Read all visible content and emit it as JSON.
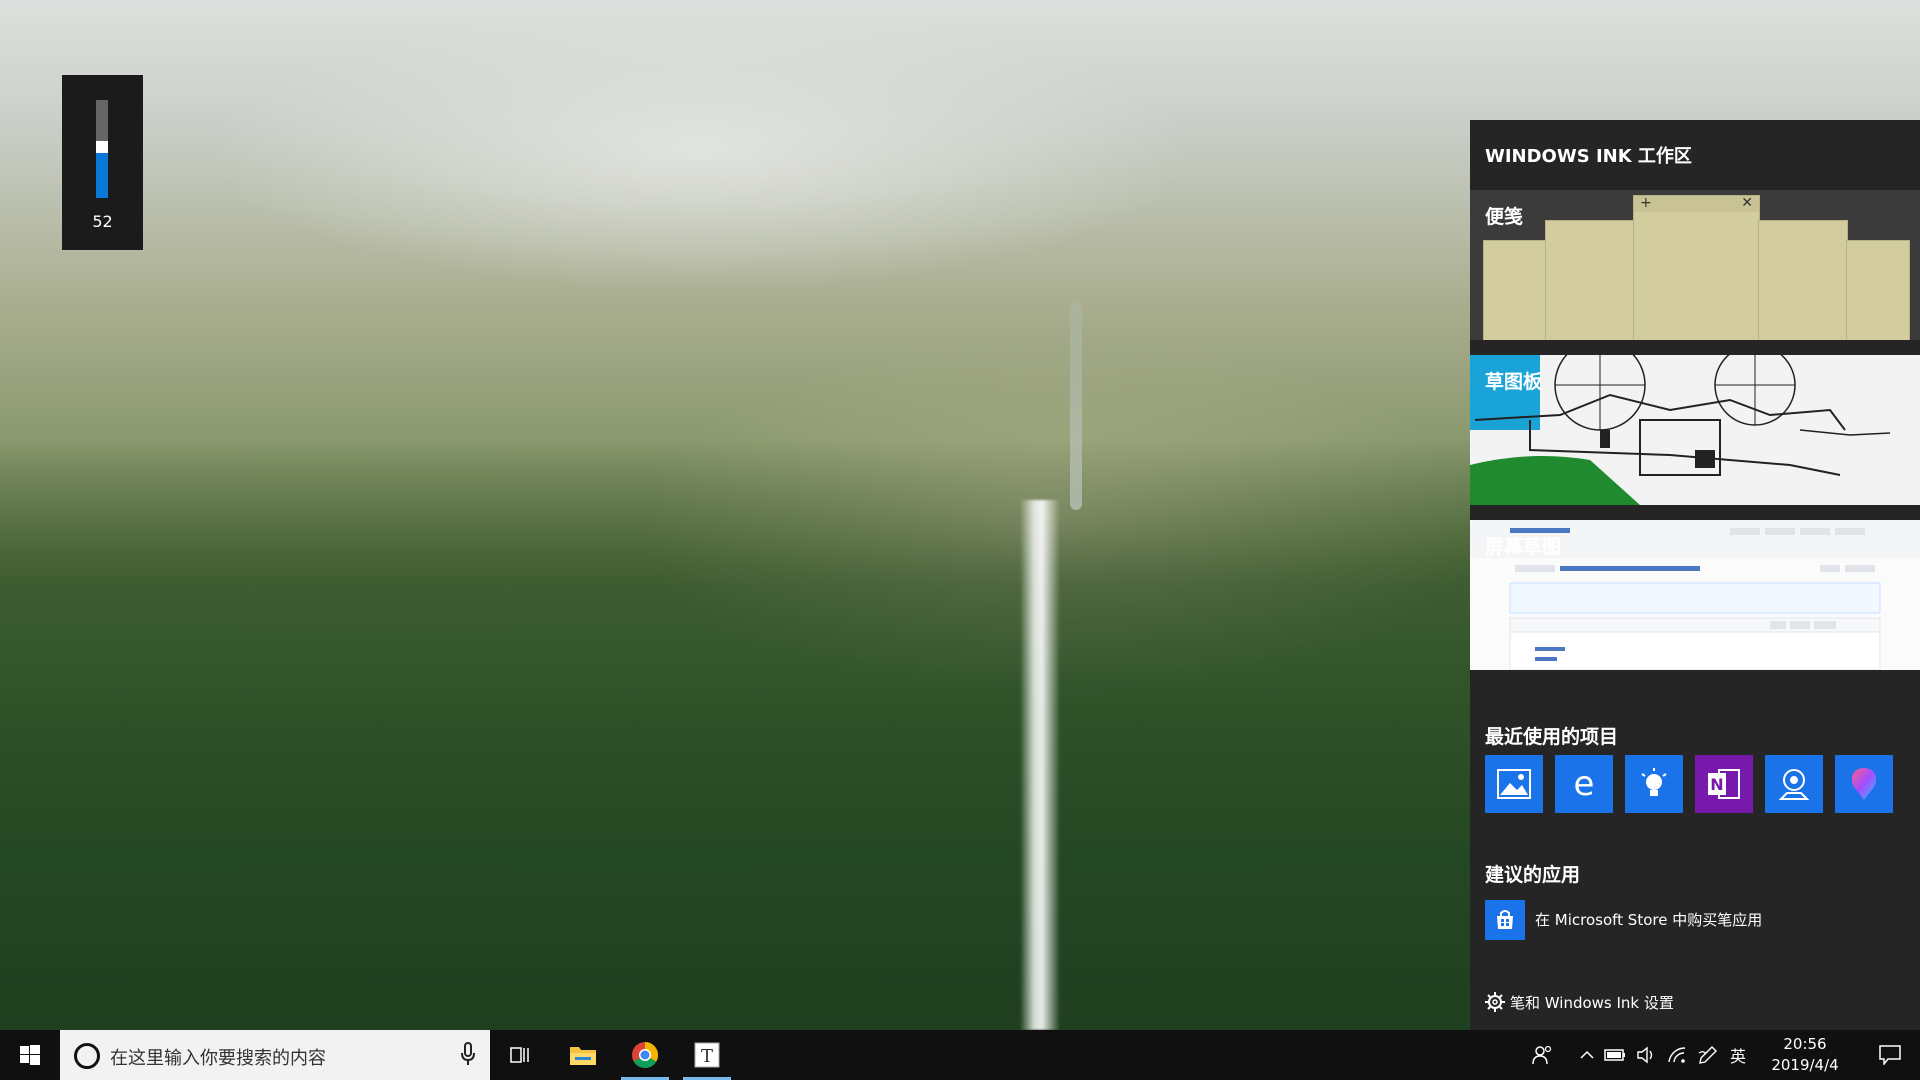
{
  "volume": {
    "level": 52,
    "label": "52"
  },
  "ink_workspace": {
    "title": "WINDOWS INK 工作区",
    "cards": {
      "sticky_notes": "便笺",
      "sketchpad": "草图板",
      "screen_sketch": "屏幕草图"
    },
    "recent_title": "最近使用的项目",
    "recent_apps": [
      {
        "name": "photos-icon",
        "color": "#1a73e8"
      },
      {
        "name": "edge-icon",
        "color": "#1a73e8"
      },
      {
        "name": "tips-icon",
        "color": "#1a73e8"
      },
      {
        "name": "onenote-icon",
        "color": "#7719aa"
      },
      {
        "name": "maps-icon",
        "color": "#1a73e8"
      },
      {
        "name": "paint3d-icon",
        "color": "#1a73e8"
      }
    ],
    "suggested_title": "建议的应用",
    "suggested_item": "在 Microsoft Store 中购买笔应用",
    "settings_link": "笔和 Windows Ink 设置"
  },
  "taskbar": {
    "search_placeholder": "在这里输入你要搜索的内容",
    "ime": "英",
    "time": "20:56",
    "date": "2019/4/4"
  }
}
